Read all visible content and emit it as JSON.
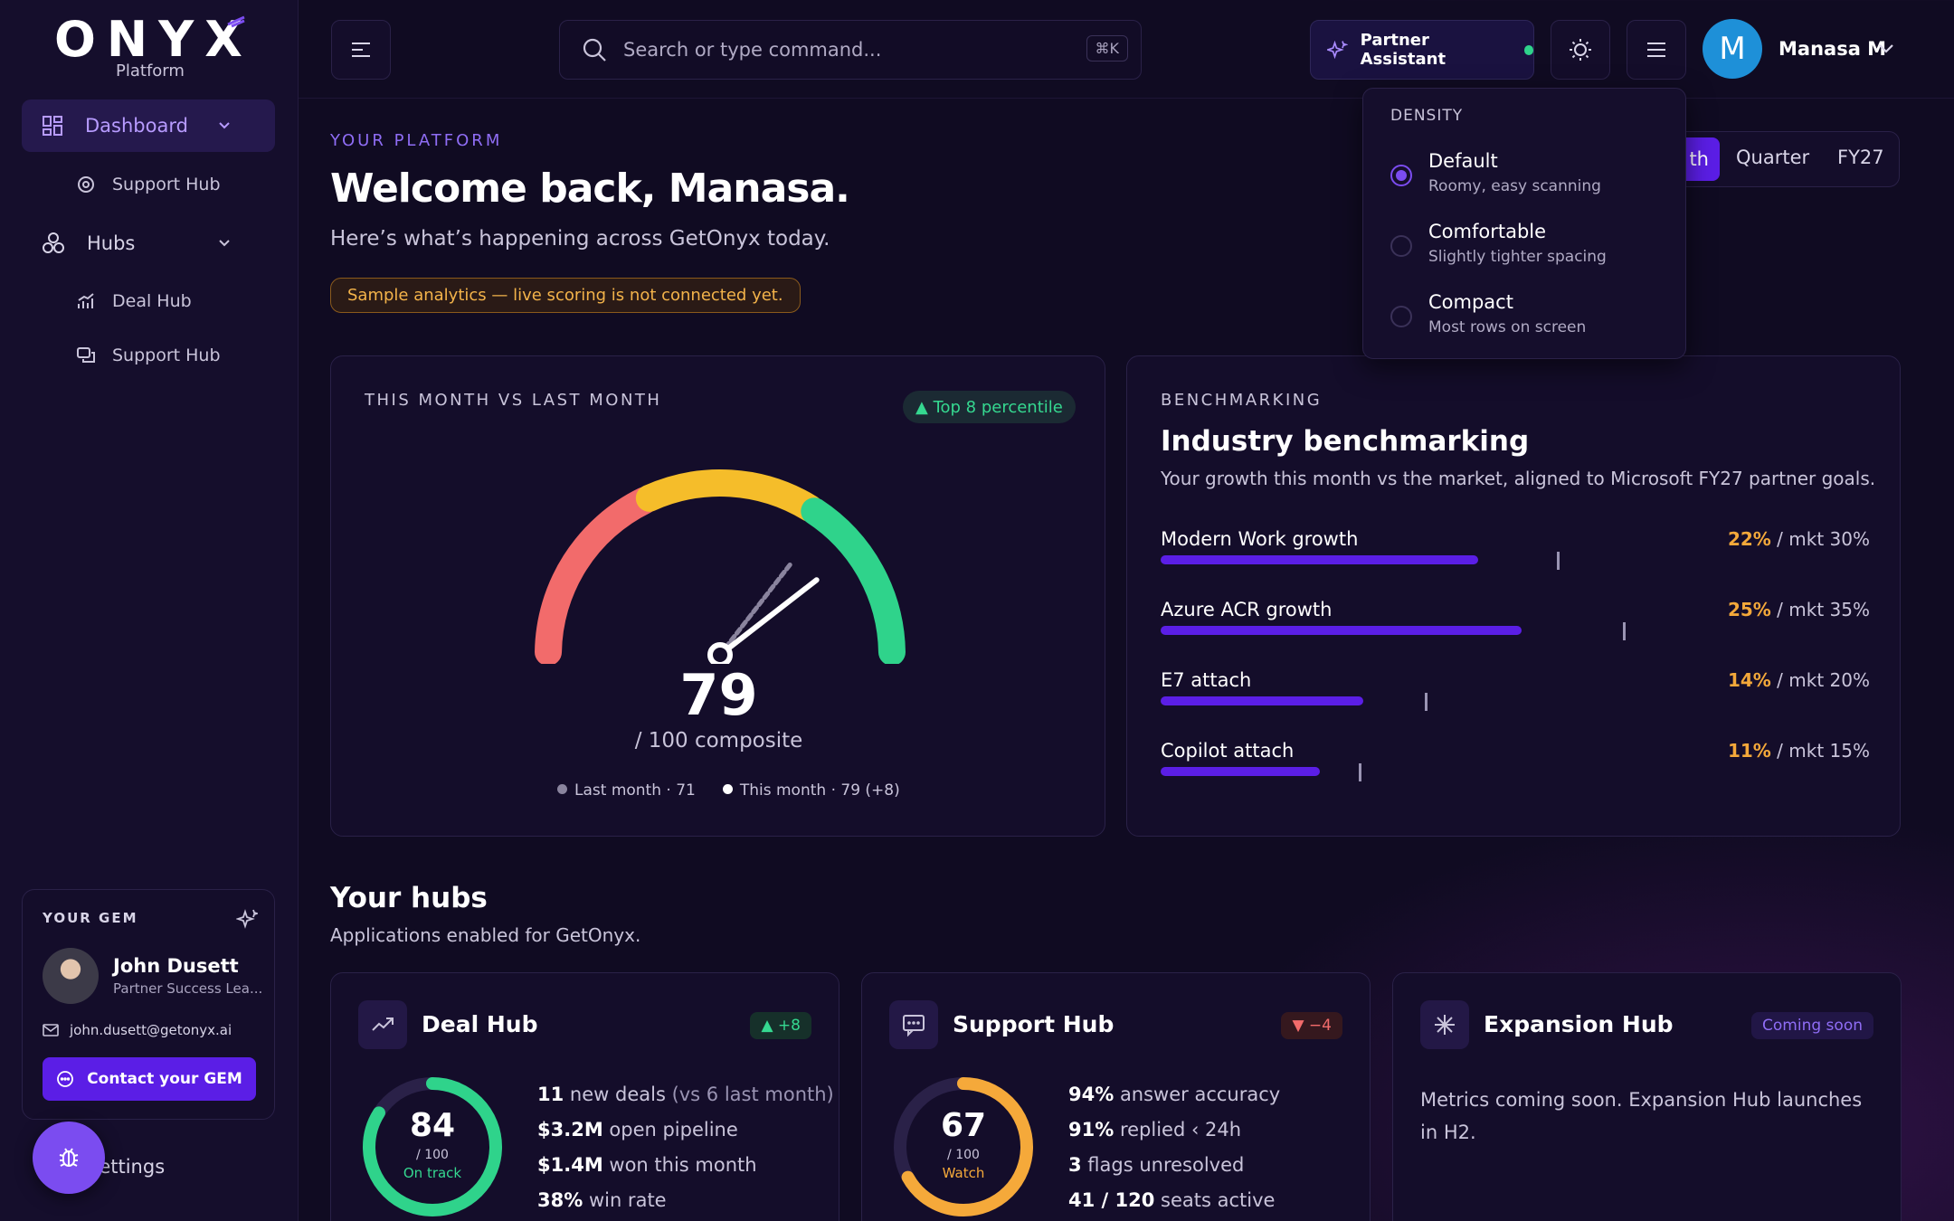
{
  "brand": {
    "logo": "ONYX",
    "sub": "Platform"
  },
  "sidebar": {
    "dashboard": "Dashboard",
    "support_hub_1": "Support Hub",
    "hubs": "Hubs",
    "deal_hub": "Deal Hub",
    "support_hub_2": "Support Hub",
    "settings": "Settings"
  },
  "gem": {
    "title": "YOUR GEM",
    "name": "John Dusett",
    "role": "Partner Success Lea...",
    "email": "john.dusett@getonyx.ai",
    "cta": "Contact your GEM"
  },
  "header": {
    "search_placeholder": "Search or type command...",
    "shortcut": "⌘K",
    "assistant": "Partner Assistant",
    "avatar_initial": "M",
    "user": "Manasa M"
  },
  "hero": {
    "eyebrow": "YOUR PLATFORM",
    "title": "Welcome back, Manasa.",
    "subtitle": "Here’s what’s happening across GetOnyx today.",
    "notice": "Sample analytics — live scoring is not connected yet."
  },
  "period": {
    "month": "th",
    "quarter": "Quarter",
    "fy": "FY27"
  },
  "density": {
    "title": "DENSITY",
    "options": [
      {
        "label": "Default",
        "sub": "Roomy, easy scanning",
        "selected": true
      },
      {
        "label": "Comfortable",
        "sub": "Slightly tighter spacing",
        "selected": false
      },
      {
        "label": "Compact",
        "sub": "Most rows on screen",
        "selected": false
      }
    ]
  },
  "gauge": {
    "title": "THIS MONTH VS LAST MONTH",
    "badge": "▲ Top 8 percentile",
    "value": "79",
    "unit": "/ 100 composite",
    "legend_last": "Last month · 71",
    "legend_this": "This month · 79 (+8)",
    "current": 79,
    "previous": 71,
    "max": 100,
    "colors": {
      "low": "#f26b6b",
      "mid": "#f5bd2a",
      "high": "#2fd38b"
    }
  },
  "bench": {
    "eyebrow": "BENCHMARKING",
    "title": "Industry benchmarking",
    "desc": "Your growth this month vs the market, aligned to Microsoft FY27 partner goals.",
    "rows": [
      {
        "label": "Modern Work growth",
        "you": "22%",
        "mkt": " / mkt 30%",
        "you_v": 22,
        "mkt_v": 30
      },
      {
        "label": "Azure ACR growth",
        "you": "25%",
        "mkt": " / mkt 35%",
        "you_v": 25,
        "mkt_v": 35
      },
      {
        "label": "E7 attach",
        "you": "14%",
        "mkt": " / mkt 20%",
        "you_v": 14,
        "mkt_v": 20
      },
      {
        "label": "Copilot attach",
        "you": "11%",
        "mkt": " / mkt 15%",
        "you_v": 11,
        "mkt_v": 15
      }
    ]
  },
  "hubs": {
    "title": "Your hubs",
    "subtitle": "Applications enabled for GetOnyx.",
    "deal": {
      "name": "Deal Hub",
      "badge": "▲ +8",
      "score": "84",
      "den": "/ 100",
      "status": "On track",
      "score_v": 84,
      "stats": [
        {
          "b": "11",
          "t": " new deals",
          "d": " (vs 6 last month)"
        },
        {
          "b": "$3.2M",
          "t": " open pipeline",
          "d": ""
        },
        {
          "b": "$1.4M",
          "t": " won this month",
          "d": ""
        },
        {
          "b": "38%",
          "t": " win rate",
          "d": ""
        }
      ]
    },
    "support": {
      "name": "Support Hub",
      "badge": "▼ −4",
      "score": "67",
      "den": "/ 100",
      "status": "Watch",
      "score_v": 67,
      "stats": [
        {
          "b": "94%",
          "t": " answer accuracy",
          "d": ""
        },
        {
          "b": "91%",
          "t": " replied ‹ 24h",
          "d": ""
        },
        {
          "b": "3",
          "t": " flags unresolved",
          "d": ""
        },
        {
          "b": "41 / 120",
          "t": " seats active",
          "d": ""
        }
      ]
    },
    "expansion": {
      "name": "Expansion Hub",
      "badge": "Coming soon",
      "text": "Metrics coming soon. Expansion Hub launches in H2."
    }
  }
}
